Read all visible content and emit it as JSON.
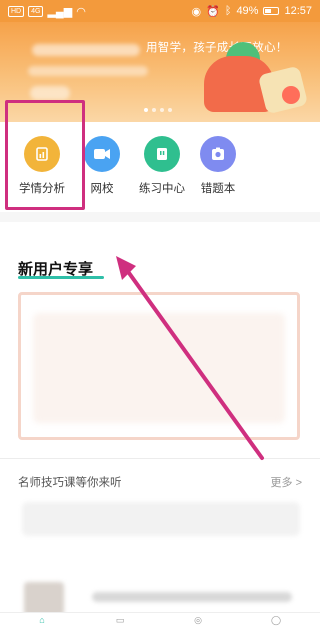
{
  "status_bar": {
    "left_chips": [
      "HD",
      "4G",
      "HD"
    ],
    "time": "12:57",
    "battery": "49%"
  },
  "banner": {
    "slogan": "用智学，孩子成长更放心！"
  },
  "quick_menu": [
    {
      "label": "学情分析",
      "icon": "report-icon",
      "color": "#f2b43a"
    },
    {
      "label": "网校",
      "icon": "video-camera-icon",
      "color": "#4aa3f2"
    },
    {
      "label": "练习中心",
      "icon": "practice-icon",
      "color": "#2fbf8f"
    },
    {
      "label": "错题本",
      "icon": "camera-book-icon",
      "color": "#7f8bf0"
    }
  ],
  "new_user": {
    "title": "新用户专享"
  },
  "courses": {
    "title": "名师技巧课等你来听",
    "more": "更多 >"
  },
  "colors": {
    "accent": "#2fbfa8",
    "annotation": "#cf2f7f",
    "banner": "#f6a24a"
  }
}
